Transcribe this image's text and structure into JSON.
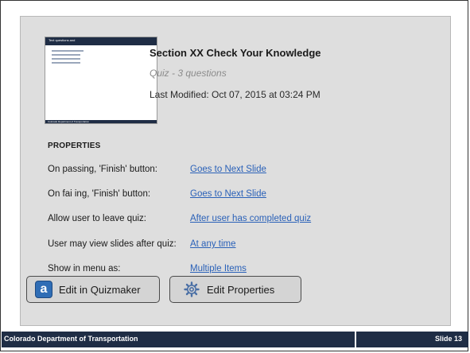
{
  "thumbnail": {
    "header_text": "Text questions and",
    "lines": [
      "Correct Answer A",
      "Wrong Answer 1",
      "Wrong Answer 2",
      "Wrong Answer 3"
    ],
    "footer_text": "Colorado Department of Transportation"
  },
  "quiz": {
    "title": "Section XX Check Your Knowledge",
    "subtitle": "Quiz - 3 questions",
    "modified": "Last Modified: Oct 07, 2015 at 03:24 PM"
  },
  "properties": {
    "heading": "PROPERTIES",
    "rows": [
      {
        "label": "On passing, 'Finish' button:",
        "value": "Goes to Next Slide"
      },
      {
        "label": "On fai ing, 'Finish' button:",
        "value": "Goes to Next Slide"
      },
      {
        "label": "Allow user to leave quiz:",
        "value": "After user has completed quiz"
      },
      {
        "label": "User may view slides after quiz:",
        "value": "At any time"
      },
      {
        "label": "Show in menu as:",
        "value": "Multiple Items"
      }
    ]
  },
  "buttons": {
    "edit_quizmaker": "Edit in Quizmaker",
    "edit_quizmaker_icon_glyph": "a",
    "edit_properties": "Edit Properties"
  },
  "footer": {
    "left": "Colorado Department of Transportation",
    "right": "Slide 13"
  },
  "colors": {
    "footer_bg": "#1f2d45",
    "panel_bg": "#dedede",
    "link": "#2a61b8",
    "quizmaker_icon": "#2f6db5"
  },
  "icons": {
    "quizmaker": "quizmaker-a-icon",
    "properties": "gear-icon"
  }
}
